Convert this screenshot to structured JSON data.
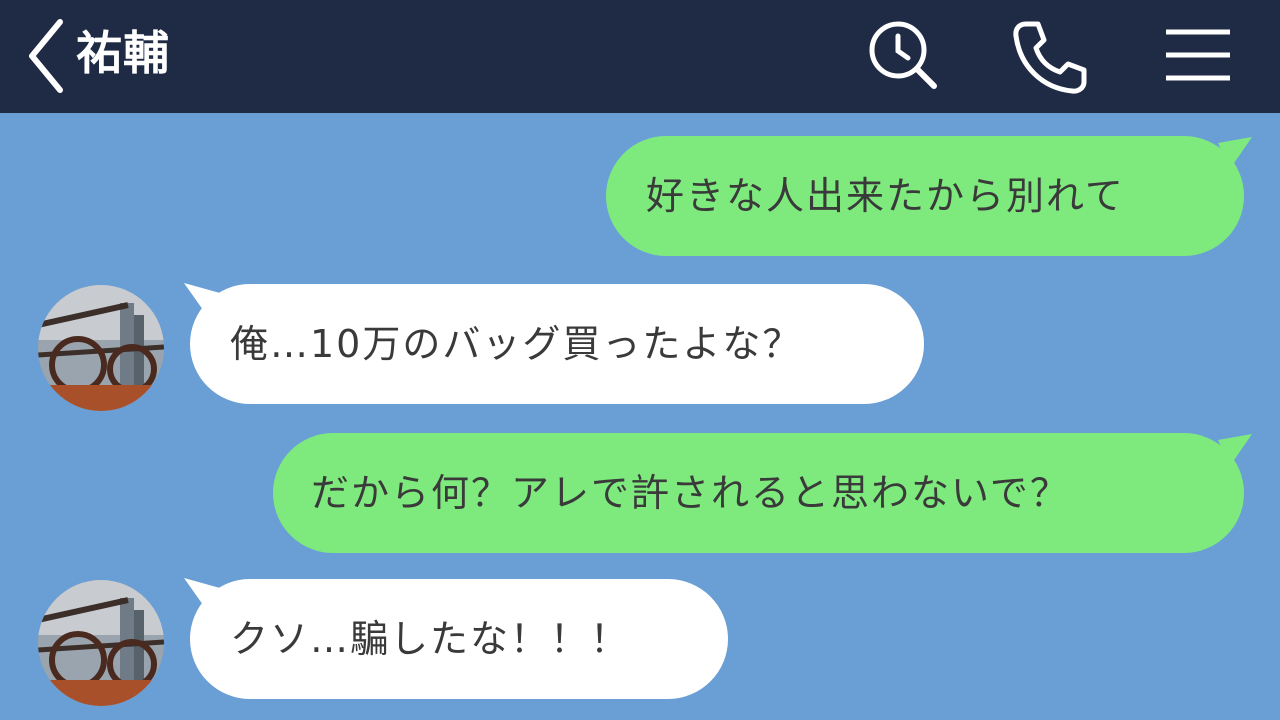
{
  "header": {
    "title": "祐輔",
    "back_icon": "chevron-left-icon",
    "search_icon": "search-clock-icon",
    "call_icon": "phone-icon",
    "menu_icon": "menu-icon",
    "bar_color": "#1f2a45"
  },
  "chat": {
    "background": "#6a9fd6",
    "messages": [
      {
        "side": "sent",
        "text": "好きな人出来たから別れて"
      },
      {
        "side": "received",
        "text": "俺…10万のバッグ買ったよな？"
      },
      {
        "side": "sent",
        "text": "だから何？アレで許されると思わないで？"
      },
      {
        "side": "received",
        "text": "クソ…騙したな！！！"
      }
    ],
    "sent_bubble_color": "#7eea7e",
    "received_bubble_color": "#ffffff"
  }
}
